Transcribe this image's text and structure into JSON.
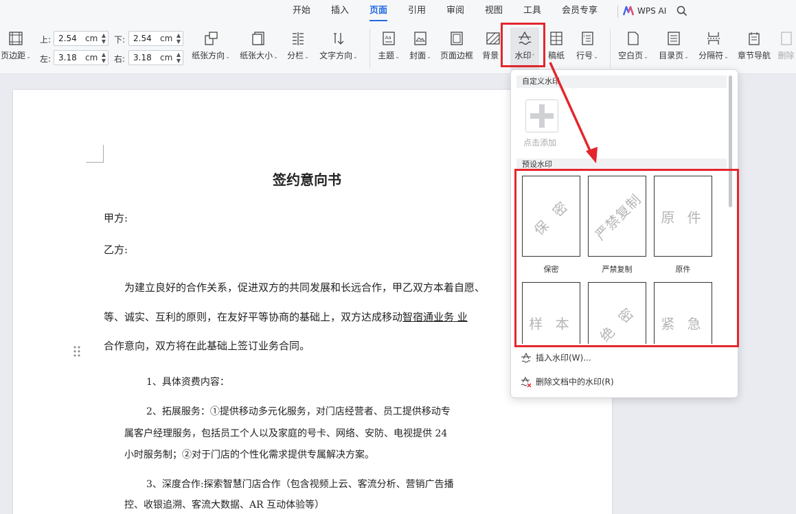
{
  "tabs": [
    "开始",
    "插入",
    "页面",
    "引用",
    "审阅",
    "视图",
    "工具",
    "会员专享"
  ],
  "active_tab": "页面",
  "wps_ai_label": "WPS AI",
  "margins": {
    "top_label": "上:",
    "top_value": "2.54",
    "bottom_label": "下:",
    "bottom_value": "2.54",
    "left_label": "左:",
    "left_value": "3.18",
    "right_label": "右:",
    "right_value": "3.18",
    "unit": "cm"
  },
  "ribbon": {
    "margins": "页边距",
    "orientation": "纸张方向",
    "size": "纸张大小",
    "columns": "分栏",
    "text_direction": "文字方向",
    "theme": "主题",
    "cover": "封面",
    "page_border": "页面边框",
    "background": "背景",
    "watermark": "水印",
    "manuscript": "稿纸",
    "line_numbers": "行号",
    "blank_page": "空白页",
    "toc_page": "目录页",
    "separator": "分隔符",
    "chapter_nav": "章节导航",
    "delete": "删除"
  },
  "document": {
    "title": "签约意向书",
    "party_a": "甲方:",
    "party_b": "乙方:",
    "p1_line1": "为建立良好的合作关系，促进双方的共同发展和长远合作，甲乙双方本着自愿、",
    "p1_line2_a": "等、诚实、互利的原则，在友好平等协商的基础上，双方达成移动",
    "p1_line2_b": "智宿通业务   业",
    "p1_line3": "合作意向，双方将在此基础上签订业务合同。",
    "item1": "1、具体资费内容：",
    "item2_line1": "2、拓展服务：①提供移动多元化服务，对门店经营者、员工提供移动专",
    "item2_line2": "属客户经理服务，包括员工个人以及家庭的号卡、网络、安防、电视提供 24",
    "item2_line3": "小时服务制；②对于门店的个性化需求提供专属解决方案。",
    "item3_line1": "3、深度合作:探索智慧门店合作（包含视频上云、客流分析、营销广告播",
    "item3_line2": "控、收银追溯、客流大数据、AR 互动体验等）"
  },
  "watermark_panel": {
    "custom_header": "自定义水印",
    "add_label": "点击添加",
    "preset_header": "预设水印",
    "presets": [
      {
        "text": "保 密",
        "caption": "保密"
      },
      {
        "text": "严禁复制",
        "caption": "严禁复制"
      },
      {
        "text": "原 件",
        "caption": "原件"
      },
      {
        "text": "样 本",
        "caption": ""
      },
      {
        "text": "绝 密",
        "caption": ""
      },
      {
        "text": "紧 急",
        "caption": ""
      }
    ],
    "insert_label": "插入水印(W)...",
    "delete_label": "删除文档中的水印(R)"
  },
  "colors": {
    "accent": "#1f6ae0",
    "highlight": "#e3262c"
  }
}
